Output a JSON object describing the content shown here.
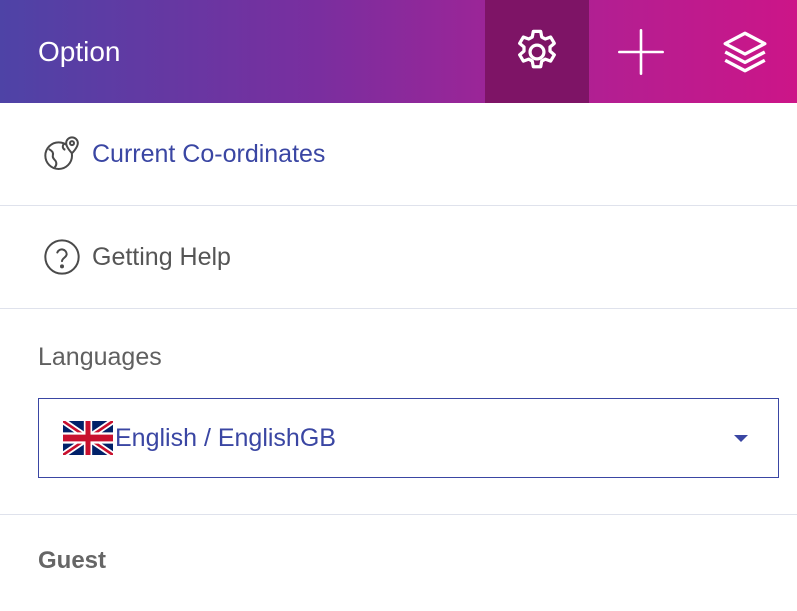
{
  "header": {
    "title": "Option",
    "buttons": [
      {
        "icon": "gear-icon",
        "active": true
      },
      {
        "icon": "plus-icon",
        "active": false
      },
      {
        "icon": "layers-icon",
        "active": false
      }
    ],
    "gradient_start": "#4e43a6",
    "gradient_end": "#cc1588",
    "active_bg": "#7e1466"
  },
  "menu": {
    "items": [
      {
        "label": "Current Co-ordinates",
        "icon": "globe-pin-icon"
      },
      {
        "label": "Getting Help",
        "icon": "help-circle-icon"
      }
    ]
  },
  "languages": {
    "label": "Languages",
    "selected": "English / EnglishGB",
    "selected_flag": "uk-flag-icon"
  },
  "user": {
    "name": "Guest"
  },
  "colors": {
    "accent": "#3a46a3",
    "divider": "#dfe2ec"
  }
}
